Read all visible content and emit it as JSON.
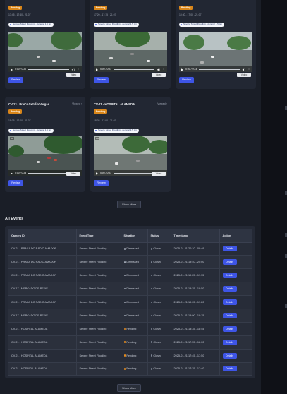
{
  "top_cards": [
    {
      "badge": "Pending",
      "time": "17:45 - 17:40 - 21:07",
      "chip": "Severe Street Flooding - general 1.5 pm",
      "video_time": "0:00 / 0:20",
      "video_label": "Video",
      "review": "Review",
      "colors": {
        "sky": "#9aa8a6",
        "road": "#4f5b5c",
        "tree": "#3f6b3c"
      }
    },
    {
      "badge": "Pending",
      "time": "17:20 - 17:15 - 21:07",
      "chip": "Severe Street Flooding - general 1.5 pm",
      "video_time": "0:00 / 0:23",
      "video_label": "Video",
      "review": "Review",
      "colors": {
        "sky": "#a6b0ab",
        "road": "#5e6866",
        "tree": "#3b6a36"
      }
    },
    {
      "badge": "Pending",
      "time": "10:30 - 17:00 - 21:07",
      "chip": "Severe Street Flooding - general 1.5 pm",
      "video_time": "0:00 / 0:23",
      "video_label": "Video",
      "review": "Review",
      "colors": {
        "sky": "#b8c2c4",
        "road": "#6c7475",
        "tree": "#4a7a45"
      }
    }
  ],
  "bottom_cards": [
    {
      "camera": "CV-13 - PraCa Getulio Vargas",
      "viewed": "Viewed",
      "badge": "Pending",
      "time": "18:05 - 17:00 - 21:07",
      "chip": "Severe Street Flooding - general 1.5 pm",
      "video_time": "0:00 / 0:23",
      "video_label": "Video",
      "review": "Review",
      "colors": {
        "sky": "#8f9c97",
        "road": "#4a5452",
        "tree": "#2f5a2f"
      }
    },
    {
      "camera": "CV-21 - HOSPITAL ALAMEDA",
      "viewed": "Viewed",
      "badge": "Pending",
      "time": "18:05 - 17:00 - 21:07",
      "chip": "Severe Street Flooding - general 1.5 pm",
      "video_time": "0:00 / 0:23",
      "video_label": "Video",
      "review": "Review",
      "colors": {
        "sky": "#b3bcb7",
        "road": "#6f7774",
        "tree": "#3d6a39"
      }
    }
  ],
  "show_more_1": "Show More",
  "show_more_2": "Show More",
  "events": {
    "title": "All Events",
    "headers": [
      "Camera ID",
      "Event Type",
      "Situation",
      "Status",
      "Timestamp",
      "Action"
    ],
    "rows": [
      {
        "camera": "CV-21 - PRACA DO RADIO AMADOR",
        "type": "Severe Street Flooding",
        "situation": "Dismissed",
        "situation_color": "#9aa1ae",
        "status": "Closed",
        "timestamp": "2025-01-21 20:10 - 09:49",
        "action": "Details"
      },
      {
        "camera": "CV-21 - PRACA DO RADIO AMADOR",
        "type": "Severe Street Flooding",
        "situation": "Dismissed",
        "situation_color": "#9aa1ae",
        "status": "Closed",
        "timestamp": "2025-01-21 19:40 - 20:00",
        "action": "Details"
      },
      {
        "camera": "CV-21 - PRACA DO RADIO AMADOR",
        "type": "Severe Street Flooding",
        "situation": "Dismissed",
        "situation_color": "#9aa1ae",
        "status": "Closed",
        "timestamp": "2025-01-21 19:25 - 19:35",
        "action": "Details"
      },
      {
        "camera": "CV-17 - MERCADO DE PEIXE",
        "type": "Severe Street Flooding",
        "situation": "Dismissed",
        "situation_color": "#9aa1ae",
        "status": "Closed",
        "timestamp": "2025-01-21 19:25 - 19:50",
        "action": "Details"
      },
      {
        "camera": "CV-21 - PRACA DO RADIO AMADOR",
        "type": "Severe Street Flooding",
        "situation": "Dismissed",
        "situation_color": "#9aa1ae",
        "status": "Closed",
        "timestamp": "2025-01-21 19:05 - 19:20",
        "action": "Details"
      },
      {
        "camera": "CV-17 - MERCADO DE PEIXE",
        "type": "Severe Street Flooding",
        "situation": "Dismissed",
        "situation_color": "#9aa1ae",
        "status": "Closed",
        "timestamp": "2025-01-21 19:00 - 19:15",
        "action": "Details"
      },
      {
        "camera": "CV-21 - HOSPITAL ALAMEDA",
        "type": "Severe Street Flooding",
        "situation": "Pending",
        "situation_color": "#e08a1e",
        "status": "Closed",
        "timestamp": "2025-01-21 18:35 - 18:45",
        "action": "Details"
      },
      {
        "camera": "CV-21 - HOSPITAL ALAMEDA",
        "type": "Severe Street Flooding",
        "situation": "Pending",
        "situation_color": "#e08a1e",
        "status": "Closed",
        "timestamp": "2025-01-21 17:55 - 18:00",
        "action": "Details"
      },
      {
        "camera": "CV-21 - HOSPITAL ALAMEDA",
        "type": "Severe Street Flooding",
        "situation": "Pending",
        "situation_color": "#e08a1e",
        "status": "Closed",
        "timestamp": "2025-01-21 17:45 - 17:50",
        "action": "Details"
      },
      {
        "camera": "CV-21 - HOSPITAL ALAMEDA",
        "type": "Severe Street Flooding",
        "situation": "Pending",
        "situation_color": "#e08a1e",
        "status": "Closed",
        "timestamp": "2025-01-21 17:35 - 17:40",
        "action": "Details"
      }
    ]
  }
}
